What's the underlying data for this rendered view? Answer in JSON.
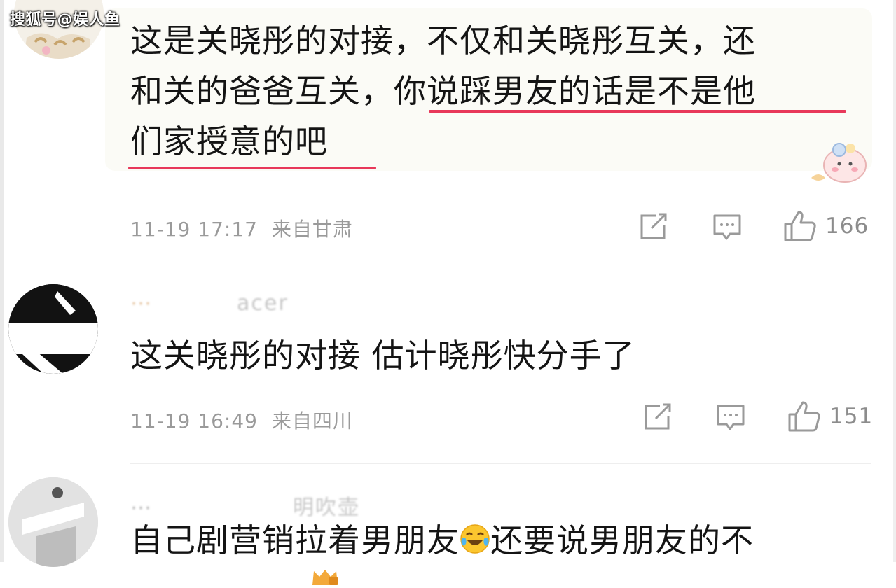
{
  "watermark": "搜狐号@娱人鱼",
  "comments": [
    {
      "text_parts": [
        "这是关晓彤的对接，不仅和关晓彤互关，还",
        "和关的爸爸互关，",
        "你说踩男友的话是不是他",
        "们家授意的吧"
      ],
      "time": "11-19 17:17",
      "location": "来自甘肃",
      "likes": "166"
    },
    {
      "username_fragment": "acer",
      "text": "这关晓彤的对接  估计晓彤快分手了",
      "time": "11-19 16:49",
      "location": "来自四川",
      "likes": "151"
    },
    {
      "username_fragment": "明吹壶",
      "text_before_emoji": "自己剧营销拉着男朋友",
      "emoji": "crying-laughing-emoji",
      "text_after_emoji": "还要说男朋友的不"
    }
  ],
  "colors": {
    "highlight_underline": "#e8385a",
    "meta_text": "#9a9a9a",
    "bubble_bg": "#fbfbf6"
  },
  "icons": [
    "share-icon",
    "comment-icon",
    "like-icon"
  ]
}
